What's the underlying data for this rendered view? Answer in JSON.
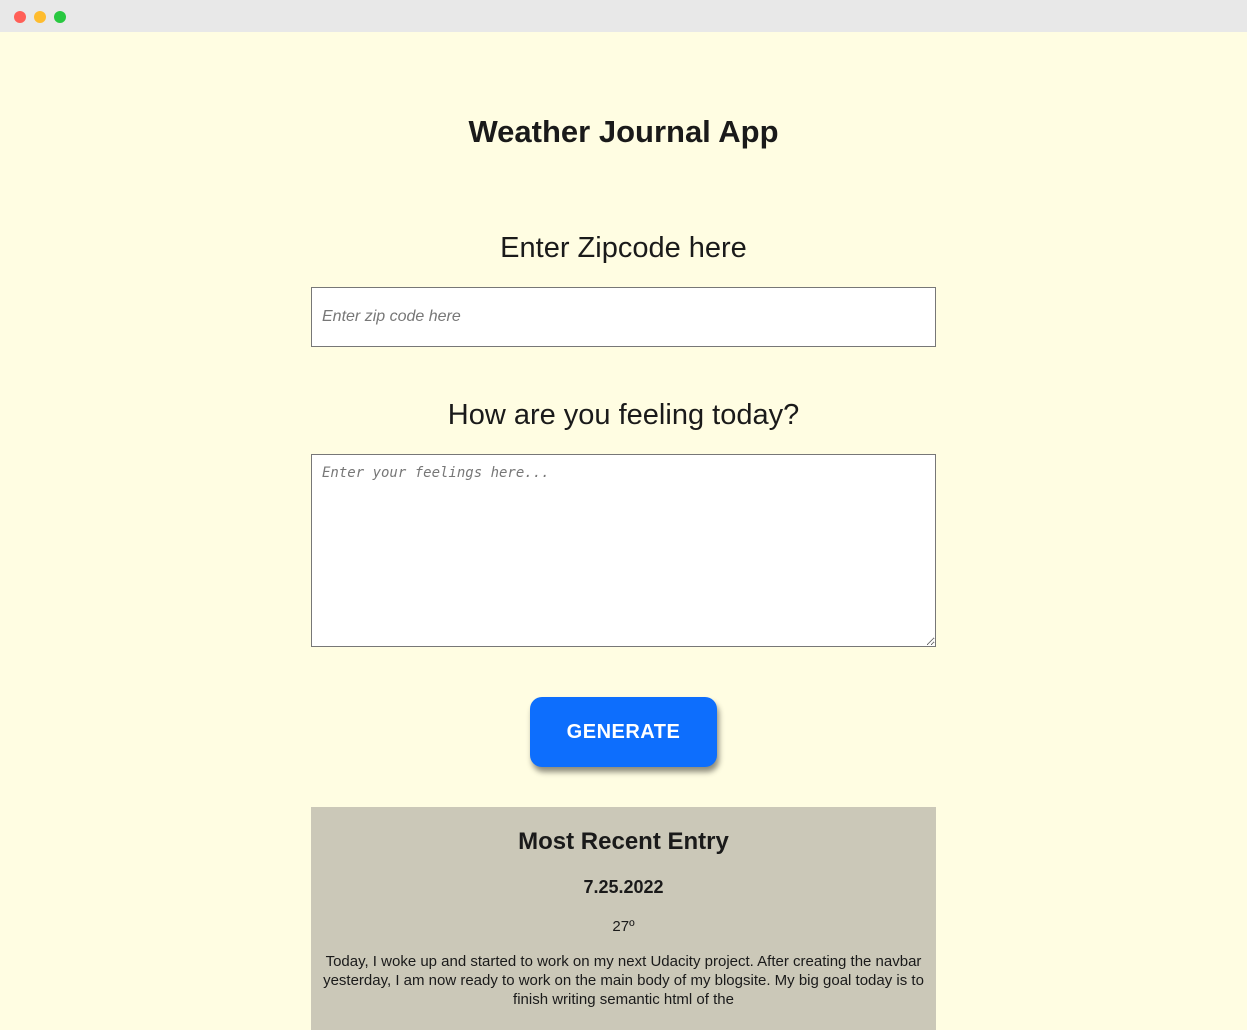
{
  "app": {
    "title": "Weather Journal App"
  },
  "zip": {
    "label": "Enter Zipcode here",
    "placeholder": "Enter zip code here",
    "value": ""
  },
  "feelings": {
    "label": "How are you feeling today?",
    "placeholder": "Enter your feelings here...",
    "value": ""
  },
  "actions": {
    "generate_label": "GENERATE",
    "generate_color": "#0d6efd"
  },
  "entry": {
    "title": "Most Recent Entry",
    "date": "7.25.2022",
    "temp": "27º",
    "content": "Today, I woke up and started to work on my next Udacity project. After creating the navbar yesterday, I am now ready to work on the main body of my blogsite. My big goal today is to finish writing semantic html of the"
  },
  "colors": {
    "page_background": "#fffde2",
    "entry_background": "#cbc8b8"
  }
}
